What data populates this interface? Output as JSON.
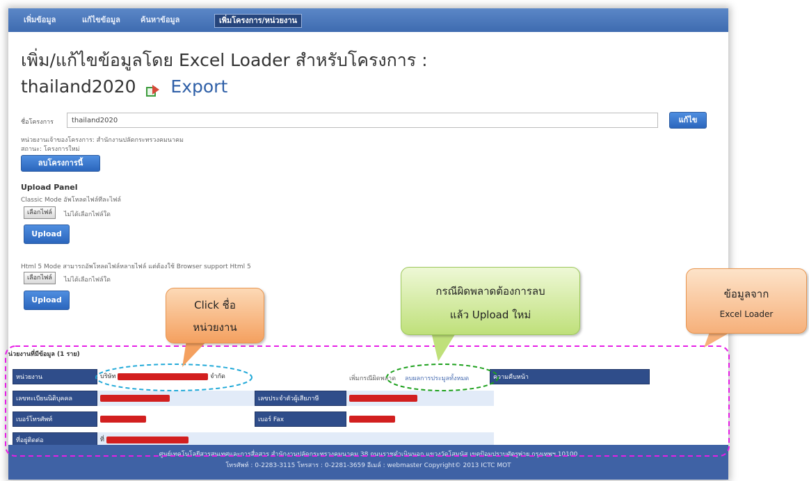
{
  "nav": {
    "items": [
      "เพิ่มข้อมูล",
      "แก้ไขข้อมูล",
      "ค้นหาข้อมูล",
      "เพิ่มโครงการ/หน่วยงาน"
    ]
  },
  "header": {
    "title_line1": "เพิ่ม/แก้ไขข้อมูลโดย Excel Loader สำหรับโครงการ :",
    "title_line2": "thailand2020",
    "export_label": "Export"
  },
  "project": {
    "field_label": "ชื่อโครงการ",
    "field_value": "thailand2020",
    "edit_button": "แก้ไข",
    "owner_text": "หน่วยงานเจ้าของโครงการ: สำนักงานปลัดกระทรวงคมนาคม",
    "status_text": "สถานะ: โครงการใหม่",
    "delete_button": "ลบโครงการนี้"
  },
  "upload": {
    "panel_title": "Upload Panel",
    "classic_text": "Classic Mode อัพโหลดไฟล์ทีละไฟล์",
    "choose_file": "เลือกไฟล์",
    "no_file": "ไม่ได้เลือกไฟล์ใด",
    "upload_button": "Upload",
    "html5_text": "Html 5 Mode สามารถอัพโหลดไฟล์หลายไฟล์ แต่ต้องใช้ Browser support Html 5"
  },
  "records": {
    "heading": "หน่วยงานที่มีข้อมูล (1 ราย)",
    "row1": {
      "h1": "หน่วยงาน",
      "v1_prefix": "บริษัท",
      "v1_suffix": "จำกัด",
      "mid": "เพิ่มกรณีผิดพลาด",
      "delete_link": "ลบผลการประมูลทั้งหมด",
      "h2": "ความคืบหน้า"
    },
    "row2": {
      "h1": "เลขทะเบียนนิติบุคคล",
      "h2": "เลขประจำตัวผู้เสียภาษี"
    },
    "row3": {
      "h1": "เบอร์โทรศัพท์",
      "h2": "เบอร์ Fax"
    },
    "row4": {
      "h1": "ที่อยู่ติดต่อ",
      "v1_prefix": "ที่"
    }
  },
  "footer": {
    "line1": "ศูนย์เทคโนโลยีสารสนเทศและการสื่อสาร สำนักงานปลัดกระทรวงคมนาคม 38 ถนนราชดำเนินนอก แขวงวัดโสมนัส เขตป้อมปราบศัตรูพ่าย กรุงเทพฯ 10100",
    "line2": "โทรศัพท์ : 0-2283-3115  โทรสาร : 0-2281-3659  อีเมล์ : webmaster  Copyright© 2013 ICTC MOT"
  },
  "callouts": {
    "click": {
      "line1": "Click ชื่อ",
      "line2": "หน่วยงาน"
    },
    "error": {
      "line1": "กรณีผิดพลาดต้องการลบ",
      "line2": "แล้ว Upload ใหม่"
    },
    "data": {
      "line1": "ข้อมูลจาก",
      "line2": "Excel Loader"
    }
  },
  "colors": {
    "nav": "#3e6bb0",
    "accent_blue": "#2b66bd",
    "table_header": "#2f4d8a",
    "dash_magenta": "#e61ee6",
    "dash_cyan": "#21a9d8",
    "dash_green": "#1ca01c"
  }
}
